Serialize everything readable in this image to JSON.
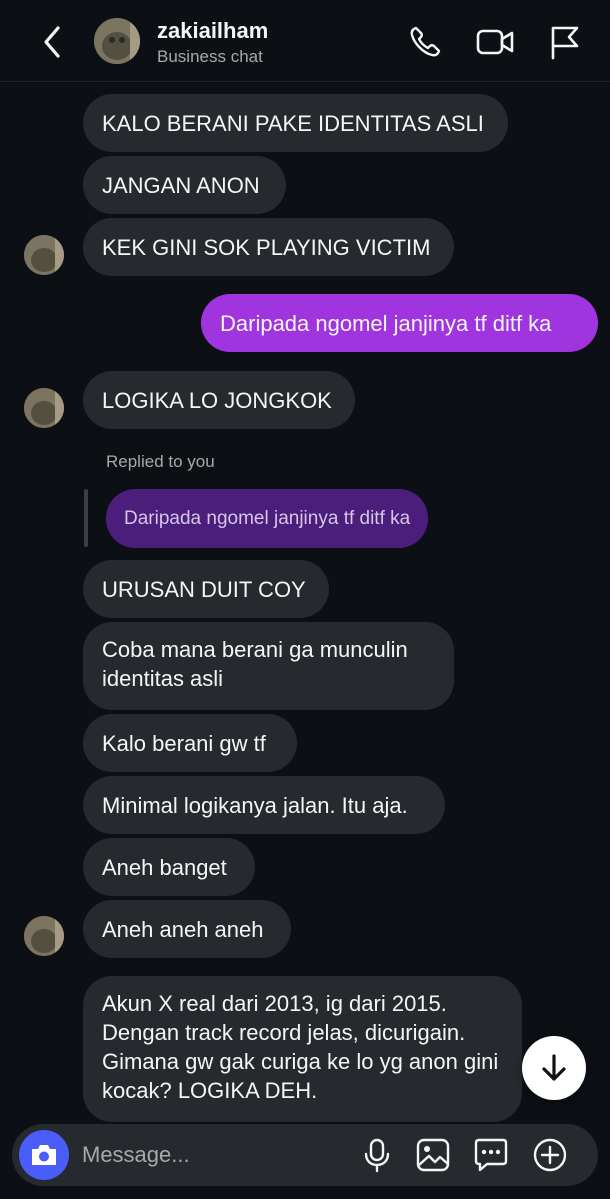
{
  "header": {
    "name": "zakiailham",
    "subtitle": "Business chat",
    "icons": [
      "back-chevron-icon",
      "phone-icon",
      "video-camera-icon",
      "flag-icon"
    ]
  },
  "messages": [
    {
      "from": "them",
      "text": "KALO BERANI PAKE IDENTITAS ASLI"
    },
    {
      "from": "them",
      "text": "JANGAN ANON"
    },
    {
      "from": "them",
      "text": "KEK GINI SOK PLAYING VICTIM"
    },
    {
      "from": "me",
      "text": "Daripada ngomel janjinya tf ditf ka"
    },
    {
      "from": "them",
      "text": "LOGIKA LO JONGKOK"
    },
    {
      "from": "them",
      "text": "URUSAN DUIT COY"
    },
    {
      "from": "them",
      "text": "Coba mana berani ga munculin identitas asli"
    },
    {
      "from": "them",
      "text": "Kalo berani gw tf"
    },
    {
      "from": "them",
      "text": "Minimal logikanya jalan. Itu aja."
    },
    {
      "from": "them",
      "text": "Aneh banget"
    },
    {
      "from": "them",
      "text": "Aneh aneh aneh"
    },
    {
      "from": "them",
      "text": "Akun X real dari 2013, ig dari 2015. Dengan track record jelas, dicurigain. Gimana gw gak curiga ke lo yg anon gini kocak? LOGIKA DEH."
    }
  ],
  "reply": {
    "label": "Replied to you",
    "quoted": "Daripada ngomel janjinya tf ditf ka"
  },
  "composer": {
    "placeholder": "Message...",
    "icons": [
      "camera-icon",
      "microphone-icon",
      "gallery-icon",
      "sticker-icon",
      "plus-icon"
    ]
  },
  "colors": {
    "background": "#0c1014",
    "incoming_bubble": "#262a2e",
    "outgoing_bubble": "#a035e0",
    "reply_bubble": "#4a1e7a",
    "camera_button": "#4a5df9"
  }
}
